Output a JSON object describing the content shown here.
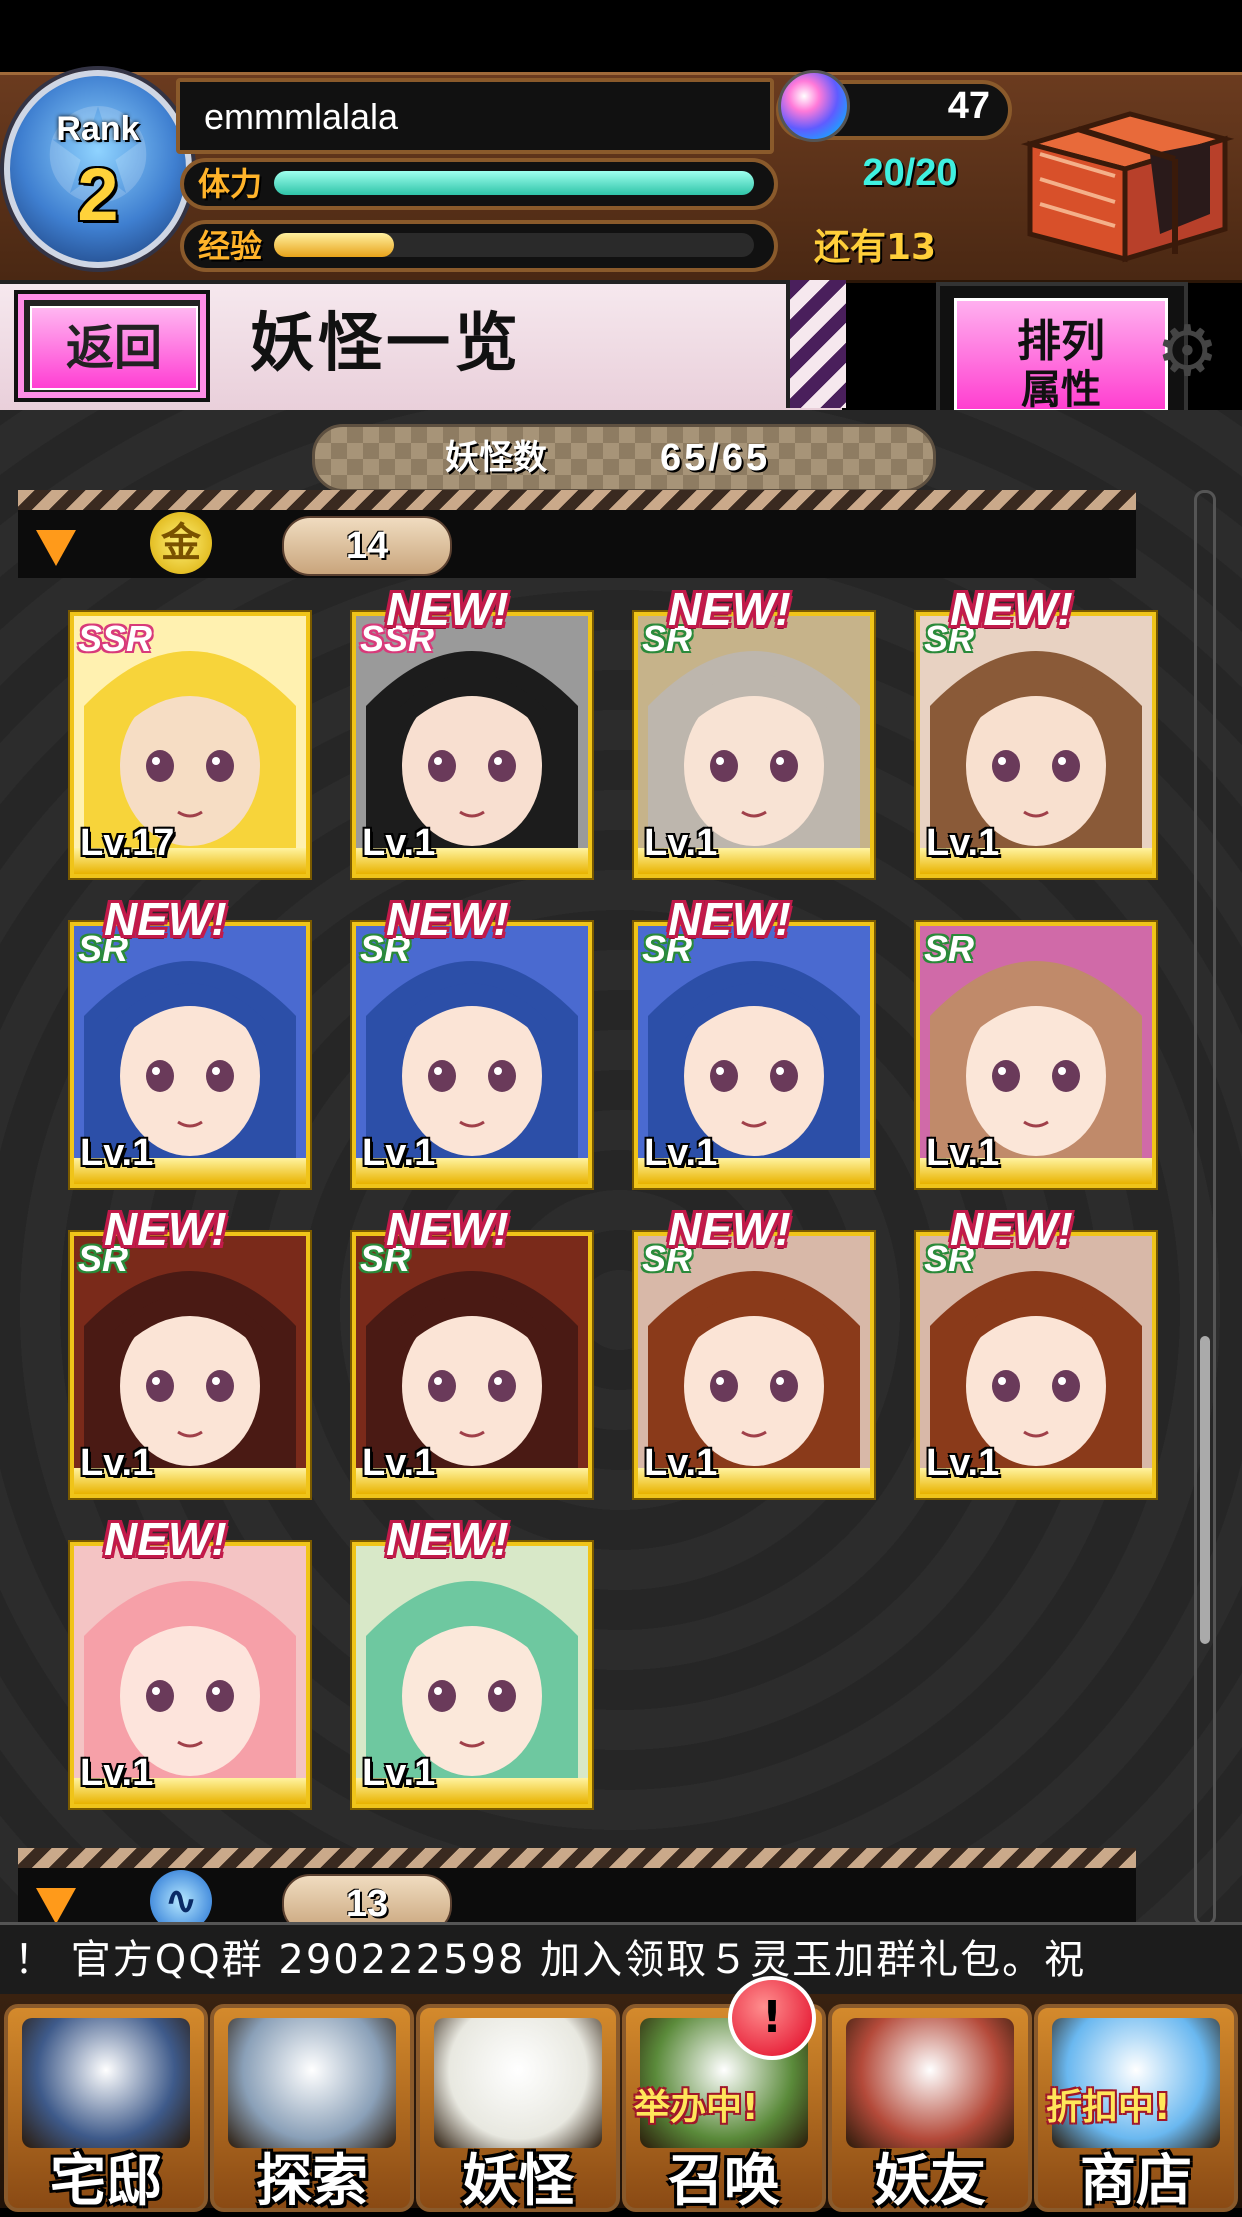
{
  "player": {
    "rank_label": "Rank",
    "rank": "2",
    "name": "emmmlalala",
    "gems": "47",
    "stamina_label": "体力",
    "stamina": "20/20",
    "stamina_fraction": 1.0,
    "exp_label": "经验",
    "exp_remaining": "还有13",
    "exp_fraction": 0.25
  },
  "titlebar": {
    "back_label": "返回",
    "title": "妖怪一览",
    "sort_label": "排列",
    "sort_value": "属性"
  },
  "summary": {
    "count_label": "妖怪数",
    "count_value": "65/65"
  },
  "groups": [
    {
      "icon": "gold-element-icon",
      "icon_text": "金",
      "count": "14"
    },
    {
      "icon": "water-element-icon",
      "icon_text": "",
      "count": "13"
    }
  ],
  "cards": [
    {
      "rarity": "SSR",
      "level": "Lv.17",
      "new": false,
      "hair": "#f7d43a",
      "skin": "#f6ddc4",
      "bg": "#fff1b0"
    },
    {
      "rarity": "SSR",
      "level": "Lv.1",
      "new": true,
      "hair": "#1c1c1c",
      "skin": "#f8dfd0",
      "bg": "#9a9a9a"
    },
    {
      "rarity": "SR",
      "level": "Lv.1",
      "new": true,
      "hair": "#bdb6ad",
      "skin": "#f8e3d4",
      "bg": "#c6b38a"
    },
    {
      "rarity": "SR",
      "level": "Lv.1",
      "new": true,
      "hair": "#8a5a38",
      "skin": "#f8e0cf",
      "bg": "#e8d2c2"
    },
    {
      "rarity": "SR",
      "level": "Lv.1",
      "new": true,
      "hair": "#2c4fa8",
      "skin": "#fbe4d6",
      "bg": "#4a6ad0"
    },
    {
      "rarity": "SR",
      "level": "Lv.1",
      "new": true,
      "hair": "#2c4fa8",
      "skin": "#fbe4d6",
      "bg": "#4a6ad0"
    },
    {
      "rarity": "SR",
      "level": "Lv.1",
      "new": true,
      "hair": "#2c4fa8",
      "skin": "#fbe4d6",
      "bg": "#4a6ad0"
    },
    {
      "rarity": "SR",
      "level": "Lv.1",
      "new": false,
      "hair": "#c08a6a",
      "skin": "#fbe6d8",
      "bg": "#d06aa8"
    },
    {
      "rarity": "SR",
      "level": "Lv.1",
      "new": true,
      "hair": "#4a1a14",
      "skin": "#fbe4d6",
      "bg": "#7a2a1a"
    },
    {
      "rarity": "SR",
      "level": "Lv.1",
      "new": true,
      "hair": "#4a1a14",
      "skin": "#fbe4d6",
      "bg": "#7a2a1a"
    },
    {
      "rarity": "SR",
      "level": "Lv.1",
      "new": true,
      "hair": "#8a3a1a",
      "skin": "#fbe4d6",
      "bg": "#d8b8a8"
    },
    {
      "rarity": "SR",
      "level": "Lv.1",
      "new": true,
      "hair": "#8a3a1a",
      "skin": "#fbe4d6",
      "bg": "#d8b8a8"
    },
    {
      "rarity": "",
      "level": "Lv.1",
      "new": true,
      "hair": "#f6a0a8",
      "skin": "#fde4dc",
      "bg": "#f4c4c4"
    },
    {
      "rarity": "",
      "level": "Lv.1",
      "new": true,
      "hair": "#6ec8a0",
      "skin": "#fbe8da",
      "bg": "#d8e8c8"
    }
  ],
  "new_badge": "NEW!",
  "ticker": "！ 官方QQ群 290222598      加入领取５灵玉加群礼包。祝",
  "nav": [
    {
      "label": "宅邸",
      "badge": "",
      "color": "#3e5a8a"
    },
    {
      "label": "探索",
      "badge": "",
      "color": "#8aa0b8"
    },
    {
      "label": "妖怪",
      "badge": "",
      "color": "#e8e8e0"
    },
    {
      "label": "召唤",
      "badge": "举办中!",
      "color": "#5a8a3a"
    },
    {
      "label": "妖友",
      "badge": "",
      "color": "#b44a3a"
    },
    {
      "label": "商店",
      "badge": "折扣中!",
      "color": "#6ab8f0"
    }
  ],
  "alert": "!",
  "colors": {
    "accent_pink": "#ff3fd3",
    "new_red": "#c21a4a",
    "gold": "#f0c419"
  }
}
